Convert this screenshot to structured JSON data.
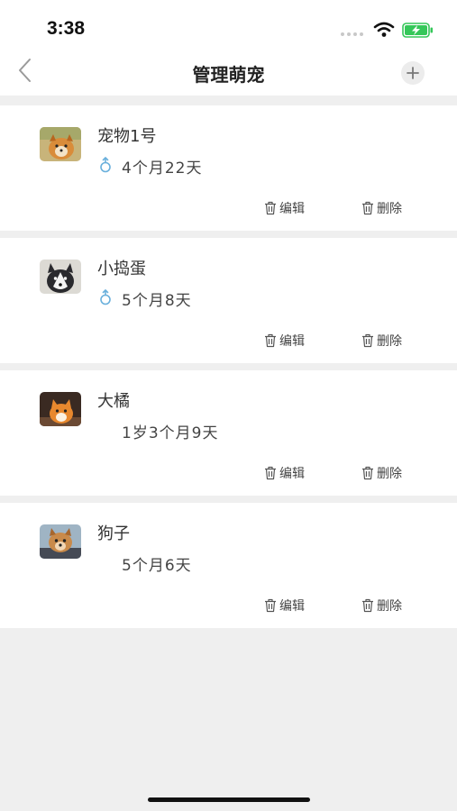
{
  "status_bar": {
    "time": "3:38"
  },
  "nav": {
    "title": "管理萌宠"
  },
  "pets": [
    {
      "name": "宠物1号",
      "age": "4个月22天",
      "gender_icon": "male-icon"
    },
    {
      "name": "小捣蛋",
      "age": "5个月8天",
      "gender_icon": "male-icon"
    },
    {
      "name": "大橘",
      "age": "1岁3个月9天",
      "gender_icon": ""
    },
    {
      "name": "狗子",
      "age": "5个月6天",
      "gender_icon": ""
    }
  ],
  "actions": {
    "edit_label": "编辑",
    "delete_label": "删除"
  },
  "colors": {
    "gender_icon": "#6ab0dc",
    "page_bg": "#efefef",
    "battery_green": "#35c759"
  }
}
